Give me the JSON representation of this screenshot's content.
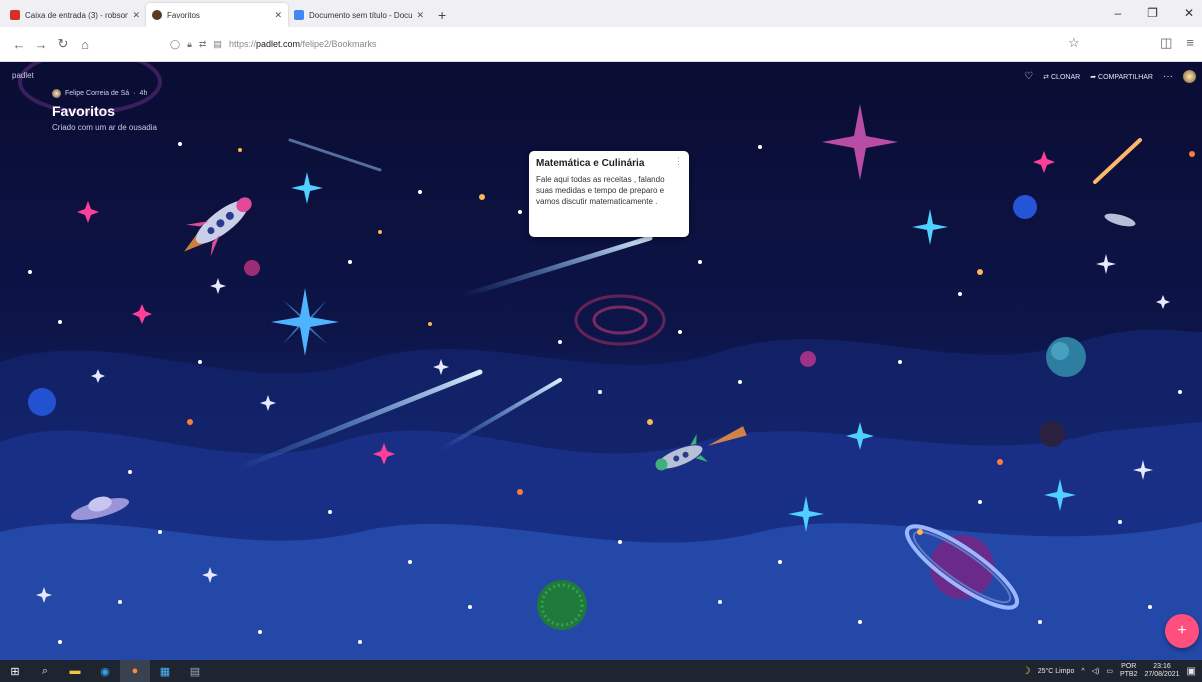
{
  "browser": {
    "tabs": [
      {
        "label": "Caixa de entrada (3) - robson.l",
        "color": "#d93025"
      },
      {
        "label": "Favoritos",
        "color": "#5a3a20"
      },
      {
        "label": "Documento sem título - Docu",
        "color": "#4285f4"
      }
    ],
    "new_tab": "+",
    "url_prefix": "https://",
    "url_domain": "padlet.com",
    "url_path": "/felipe2/Bookmarks",
    "window_controls": [
      "–",
      "❐",
      "✕"
    ]
  },
  "padlet": {
    "brand": "padlet",
    "author": "Felipe Correia de Sá",
    "age": "4h",
    "title": "Favoritos",
    "subtitle": "Criado com um ar de ousadia",
    "actions": {
      "clone": "CLONAR",
      "share": "COMPARTILHAR",
      "more": "···"
    },
    "post": {
      "title": "Matemática e Culinária",
      "body": "Fale aqui todas as receitas , falando suas medidas e tempo de preparo e vamos discutir matematicamente ."
    },
    "fab": "+"
  },
  "taskbar": {
    "weather": "25°C Limpo",
    "lang_top": "POR",
    "lang_bottom": "PTB2",
    "time": "23:16",
    "date": "27/08/2021"
  },
  "colors": {
    "accent": "#ff4f7e",
    "sky_top": "#0a0d33",
    "sky_bottom": "#2143a0"
  }
}
